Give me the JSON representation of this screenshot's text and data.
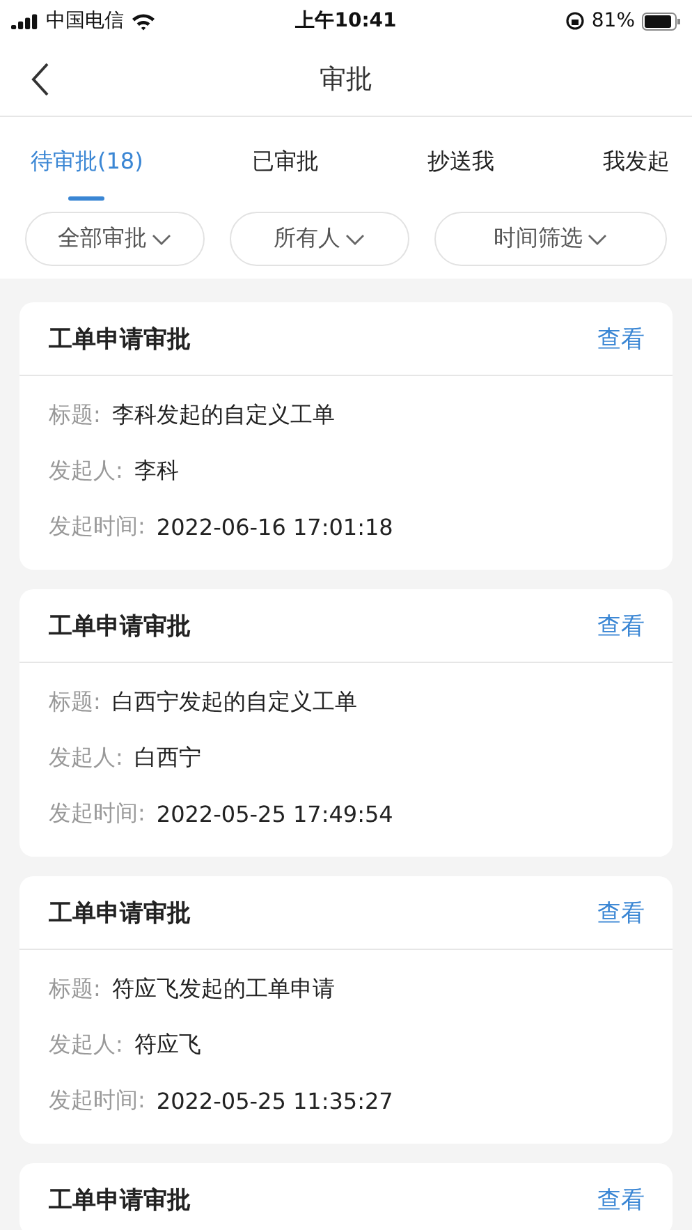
{
  "status_bar": {
    "carrier": "中国电信",
    "time": "上午10:41",
    "battery": "81%"
  },
  "nav": {
    "title": "审批"
  },
  "tabs": [
    {
      "label": "待审批(18)",
      "selected": true
    },
    {
      "label": "已审批",
      "selected": false
    },
    {
      "label": "抄送我",
      "selected": false
    },
    {
      "label": "我发起",
      "selected": false
    }
  ],
  "filters": [
    {
      "label": "全部审批"
    },
    {
      "label": "所有人"
    },
    {
      "label": "时间筛选"
    }
  ],
  "cards": [
    {
      "title": "工单申请审批",
      "action": "查看",
      "fields": [
        {
          "label": "标题:",
          "value": "李科发起的自定义工单"
        },
        {
          "label": "发起人:",
          "value": "李科"
        },
        {
          "label": "发起时间:",
          "value": "2022-06-16 17:01:18"
        }
      ]
    },
    {
      "title": "工单申请审批",
      "action": "查看",
      "fields": [
        {
          "label": "标题:",
          "value": "白西宁发起的自定义工单"
        },
        {
          "label": "发起人:",
          "value": "白西宁"
        },
        {
          "label": "发起时间:",
          "value": "2022-05-25 17:49:54"
        }
      ]
    },
    {
      "title": "工单申请审批",
      "action": "查看",
      "fields": [
        {
          "label": "标题:",
          "value": "符应飞发起的工单申请"
        },
        {
          "label": "发起人:",
          "value": "符应飞"
        },
        {
          "label": "发起时间:",
          "value": "2022-05-25 11:35:27"
        }
      ]
    },
    {
      "title": "工单申请审批",
      "action": "查看"
    }
  ]
}
